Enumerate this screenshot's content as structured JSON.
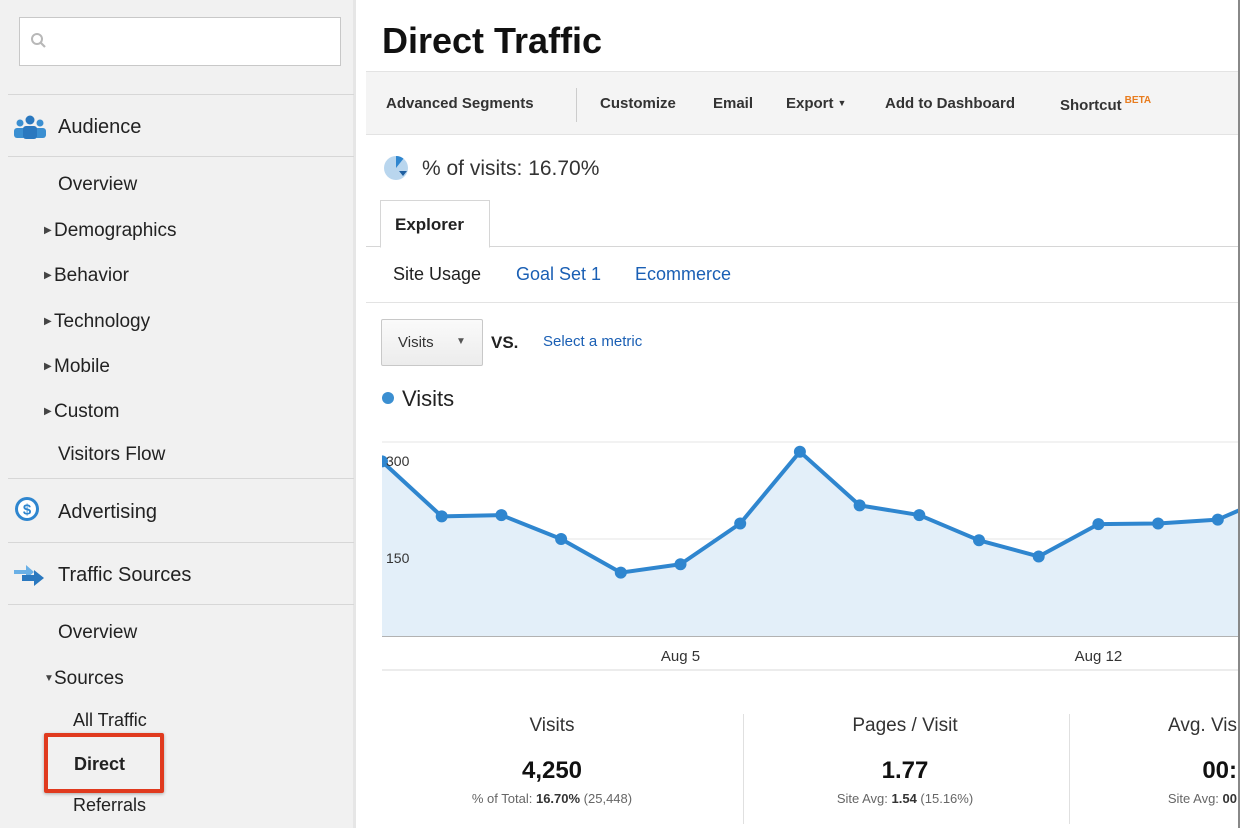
{
  "sidebar": {
    "search_placeholder": "",
    "sections": [
      {
        "label": "Audience",
        "icon": "audience-icon"
      },
      {
        "label": "Advertising",
        "icon": "dollar-icon"
      },
      {
        "label": "Traffic Sources",
        "icon": "traffic-arrows-icon"
      }
    ],
    "audience_items": [
      "Overview",
      "Demographics",
      "Behavior",
      "Technology",
      "Mobile",
      "Custom",
      "Visitors Flow"
    ],
    "traffic_items": {
      "overview": "Overview",
      "sources": "Sources",
      "all_traffic": "All Traffic",
      "direct": "Direct",
      "referrals": "Referrals"
    }
  },
  "main": {
    "title": "Direct Traffic",
    "toolbar": {
      "advanced_segments": "Advanced Segments",
      "customize": "Customize",
      "email": "Email",
      "export": "Export",
      "add_to_dashboard": "Add to Dashboard",
      "shortcut": "Shortcut",
      "beta": "BETA"
    },
    "pct_of_visits": "% of visits: 16.70%",
    "tab": "Explorer",
    "subtabs": [
      "Site Usage",
      "Goal Set 1",
      "Ecommerce"
    ],
    "metric_select": "Visits",
    "vs_label": "VS.",
    "select_metric_link": "Select a metric",
    "legend_label": "Visits",
    "stats": [
      {
        "label": "Visits",
        "value": "4,250",
        "sub_prefix": "% of Total: ",
        "sub_bold": "16.70%",
        "sub_suffix": " (25,448)"
      },
      {
        "label": "Pages / Visit",
        "value": "1.77",
        "sub_prefix": "Site Avg: ",
        "sub_bold": "1.54",
        "sub_suffix": " (15.16%)"
      },
      {
        "label": "Avg. Vis",
        "value": "00:",
        "sub_prefix": "Site Avg: ",
        "sub_bold": "00",
        "sub_suffix": ""
      }
    ]
  },
  "colors": {
    "accent_blue": "#3b8fd1",
    "link_blue": "#1a5fb4",
    "highlight_red": "#e03a1e",
    "beta_orange": "#e87c1e"
  },
  "chart_data": {
    "type": "area",
    "series": [
      {
        "name": "Visits",
        "values": [
          270,
          185,
          187,
          150,
          98,
          111,
          174,
          285,
          202,
          187,
          148,
          123,
          173,
          174,
          180,
          220
        ]
      }
    ],
    "x_tick_labels": [
      {
        "label": "Aug 5",
        "index": 5
      },
      {
        "label": "Aug 12",
        "index": 12
      }
    ],
    "y_ticks": [
      300,
      150
    ],
    "ylim": [
      0,
      300
    ],
    "grid": true
  }
}
